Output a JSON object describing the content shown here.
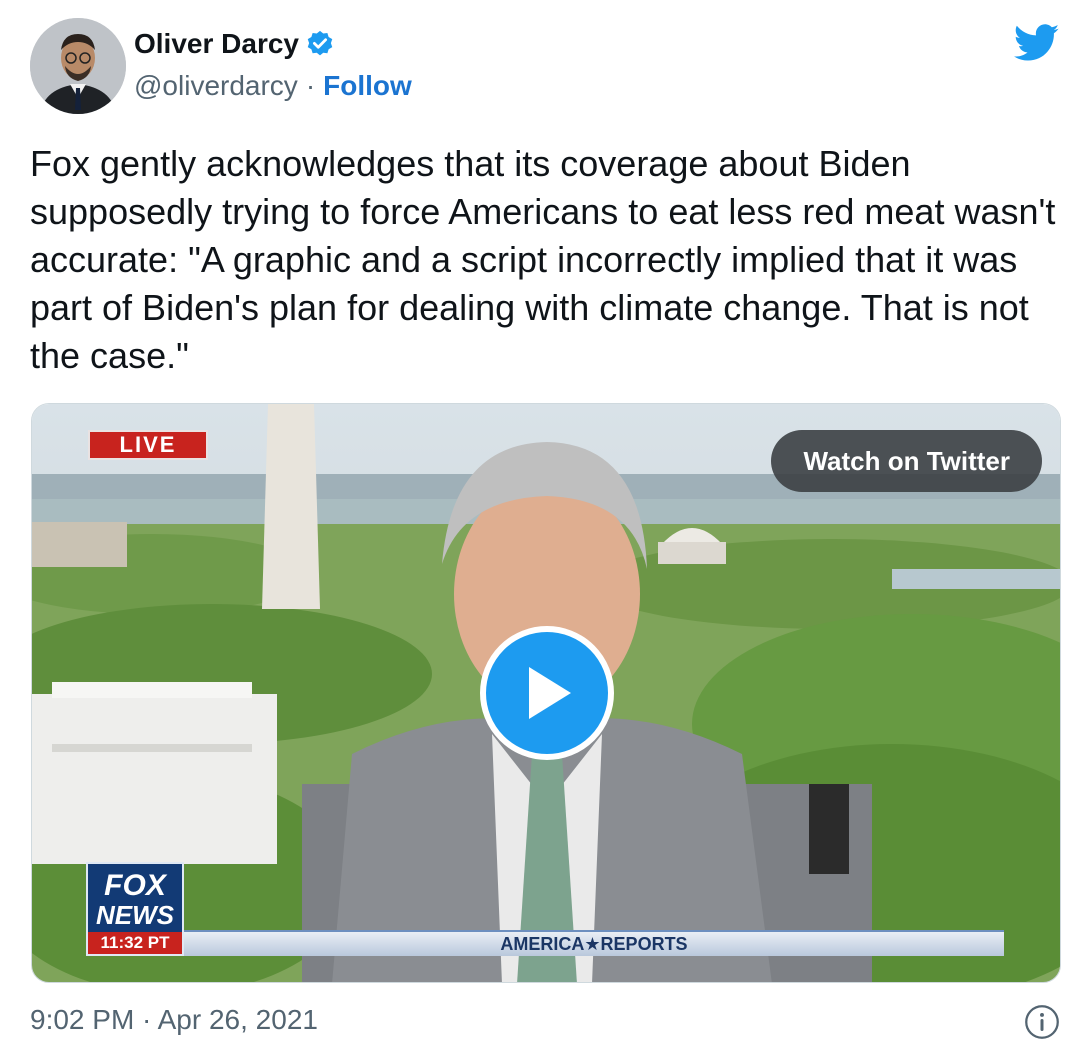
{
  "author": {
    "display_name": "Oliver Darcy",
    "handle": "@oliverdarcy",
    "separator": "·",
    "follow_label": "Follow"
  },
  "tweet": {
    "text": "Fox gently acknowledges that its coverage about Biden supposedly trying to force Americans to eat less red meat wasn't accurate: \"A graphic and a script incorrectly implied that it was part of Biden's plan for dealing with climate change. That is not the case.\""
  },
  "media": {
    "live_label": "LIVE",
    "watch_label": "Watch on Twitter",
    "logo_line1": "FOX",
    "logo_line2": "NEWS",
    "logo_time": "11:32 PT",
    "lower_third": "AMERICA★REPORTS"
  },
  "footer": {
    "timestamp": "9:02 PM · Apr 26, 2021"
  },
  "icons": {
    "verified": "verified-badge-icon",
    "bird": "twitter-bird-icon",
    "play": "play-icon",
    "info": "info-icon"
  },
  "colors": {
    "follow": "#1b74d1",
    "twitter_blue": "#1d9bf0",
    "secondary_text": "#536471",
    "live_red": "#c8231e"
  }
}
